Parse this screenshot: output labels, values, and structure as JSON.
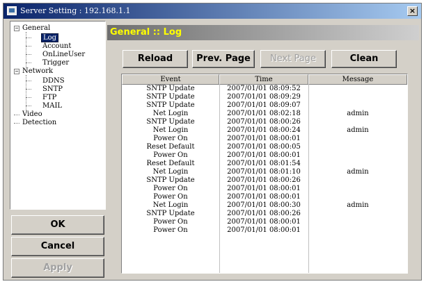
{
  "window": {
    "title": "Server Setting : 192.168.1.1",
    "close_label": "×"
  },
  "tree": {
    "general": {
      "label": "General",
      "expander": "−",
      "children": [
        "Log",
        "Account",
        "OnLineUser",
        "Trigger"
      ]
    },
    "network": {
      "label": "Network",
      "expander": "−",
      "children": [
        "DDNS",
        "SNTP",
        "FTP",
        "MAIL"
      ]
    },
    "video": {
      "label": "Video"
    },
    "detection": {
      "label": "Detection"
    },
    "selected": "Log"
  },
  "buttons": {
    "ok": "OK",
    "cancel": "Cancel",
    "apply": "Apply"
  },
  "panel": {
    "title": "General :: Log"
  },
  "toolbar": {
    "reload": "Reload",
    "prev_page": "Prev. Page",
    "next_page": "Next Page",
    "clean": "Clean"
  },
  "table": {
    "columns": [
      "Event",
      "Time",
      "Message"
    ],
    "rows": [
      {
        "event": "SNTP Update",
        "time": "2007/01/01 08:09:52",
        "message": ""
      },
      {
        "event": "SNTP Update",
        "time": "2007/01/01 08:09:29",
        "message": ""
      },
      {
        "event": "SNTP Update",
        "time": "2007/01/01 08:09:07",
        "message": ""
      },
      {
        "event": "Net Login",
        "time": "2007/01/01 08:02:18",
        "message": "admin"
      },
      {
        "event": "SNTP Update",
        "time": "2007/01/01 08:00:26",
        "message": ""
      },
      {
        "event": "Net Login",
        "time": "2007/01/01 08:00:24",
        "message": "admin"
      },
      {
        "event": "Power On",
        "time": "2007/01/01 08:00:01",
        "message": ""
      },
      {
        "event": "Reset Default",
        "time": "2007/01/01 08:00:05",
        "message": ""
      },
      {
        "event": "Power On",
        "time": "2007/01/01 08:00:01",
        "message": ""
      },
      {
        "event": "Reset Default",
        "time": "2007/01/01 08:01:54",
        "message": ""
      },
      {
        "event": "Net Login",
        "time": "2007/01/01 08:01:10",
        "message": "admin"
      },
      {
        "event": "SNTP Update",
        "time": "2007/01/01 08:00:26",
        "message": ""
      },
      {
        "event": "Power On",
        "time": "2007/01/01 08:00:01",
        "message": ""
      },
      {
        "event": "Power On",
        "time": "2007/01/01 08:00:01",
        "message": ""
      },
      {
        "event": "Net Login",
        "time": "2007/01/01 08:00:30",
        "message": "admin"
      },
      {
        "event": "SNTP Update",
        "time": "2007/01/01 08:00:26",
        "message": ""
      },
      {
        "event": "Power On",
        "time": "2007/01/01 08:00:01",
        "message": ""
      },
      {
        "event": "Power On",
        "time": "2007/01/01 08:00:01",
        "message": ""
      }
    ]
  }
}
